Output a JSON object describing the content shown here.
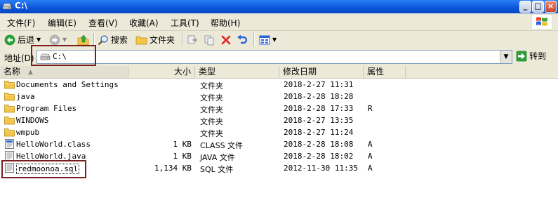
{
  "window": {
    "title": "C:\\"
  },
  "menu": [
    "文件(F)",
    "编辑(E)",
    "查看(V)",
    "收藏(A)",
    "工具(T)",
    "帮助(H)"
  ],
  "toolbar": {
    "back": "后退",
    "search": "搜索",
    "folders": "文件夹"
  },
  "address": {
    "label": "地址(D)",
    "value": "C:\\",
    "go": "转到"
  },
  "columns": {
    "name": "名称",
    "size": "大小",
    "type": "类型",
    "modified": "修改日期",
    "attributes": "属性"
  },
  "files": [
    {
      "name": "Documents and Settings",
      "size": "",
      "type": "文件夹",
      "modified": "2018-2-27 11:31",
      "attr": "",
      "icon": "folder-icon"
    },
    {
      "name": "java",
      "size": "",
      "type": "文件夹",
      "modified": "2018-2-28 18:28",
      "attr": "",
      "icon": "folder-icon"
    },
    {
      "name": "Program Files",
      "size": "",
      "type": "文件夹",
      "modified": "2018-2-28 17:33",
      "attr": "R",
      "icon": "folder-icon"
    },
    {
      "name": "WINDOWS",
      "size": "",
      "type": "文件夹",
      "modified": "2018-2-27 13:35",
      "attr": "",
      "icon": "folder-icon"
    },
    {
      "name": "wmpub",
      "size": "",
      "type": "文件夹",
      "modified": "2018-2-27 11:24",
      "attr": "",
      "icon": "folder-icon"
    },
    {
      "name": "HelloWorld.class",
      "size": "1 KB",
      "type": "CLASS 文件",
      "modified": "2018-2-28 18:08",
      "attr": "A",
      "icon": "class-file-icon"
    },
    {
      "name": "HelloWorld.java",
      "size": "1 KB",
      "type": "JAVA 文件",
      "modified": "2018-2-28 18:02",
      "attr": "A",
      "icon": "text-file-icon"
    },
    {
      "name": "redmoonoa.sql",
      "size": "1,134 KB",
      "type": "SQL 文件",
      "modified": "2012-11-30 11:35",
      "attr": "A",
      "icon": "text-file-icon"
    }
  ],
  "colors": {
    "titlebar": "#0a55d8",
    "highlight_box": "#7a1f20"
  }
}
